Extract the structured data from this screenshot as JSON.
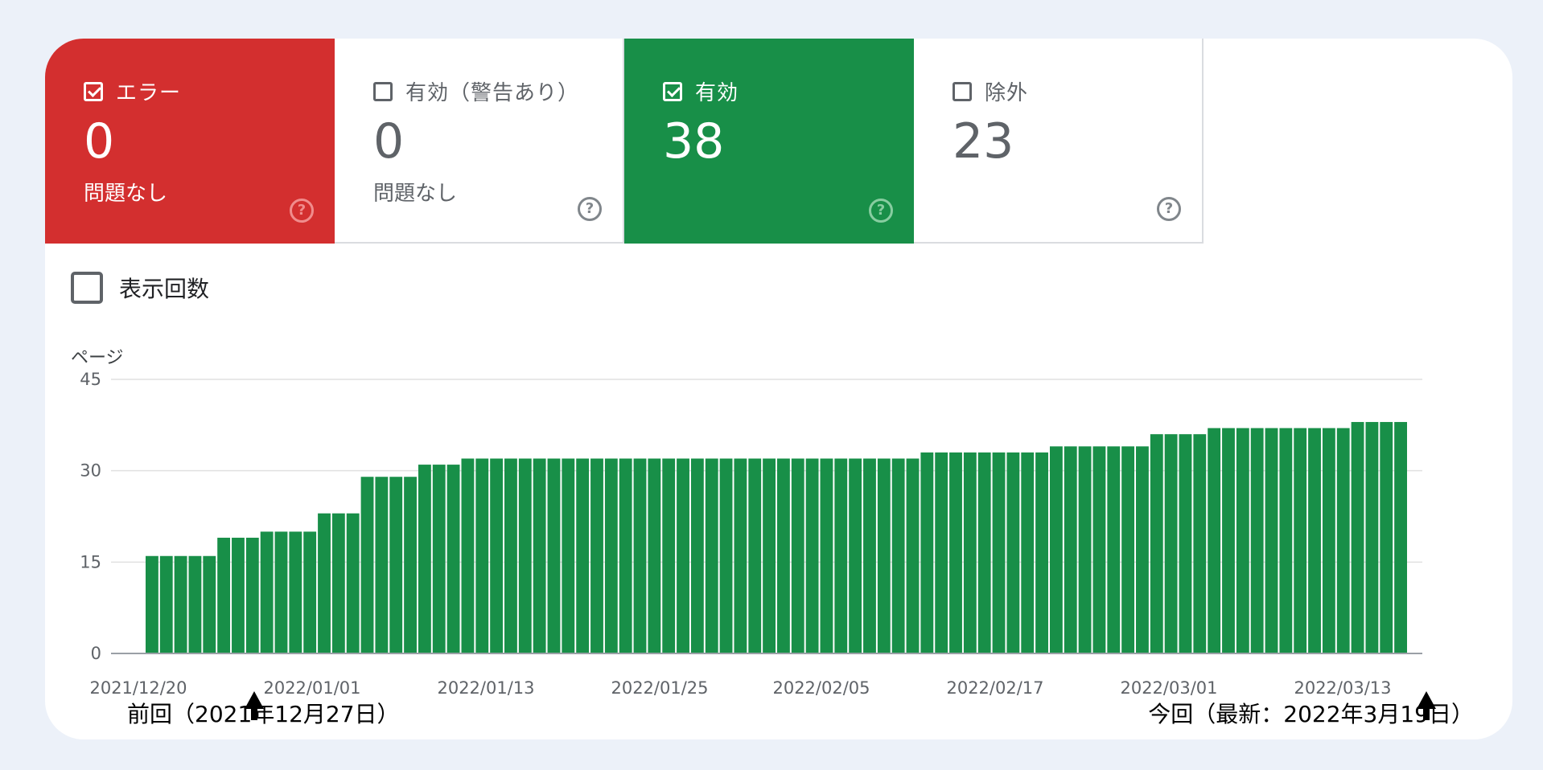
{
  "tiles": [
    {
      "label": "エラー",
      "value": "0",
      "sub": "問題なし",
      "checked": true
    },
    {
      "label": "有効（警告あり）",
      "value": "0",
      "sub": "問題なし",
      "checked": false
    },
    {
      "label": "有効",
      "value": "38",
      "sub": "",
      "checked": true
    },
    {
      "label": "除外",
      "value": "23",
      "sub": "",
      "checked": false
    }
  ],
  "impressions_label": "表示回数",
  "help_glyph": "?",
  "colors": {
    "error": "#d32f2f",
    "valid": "#188f48",
    "bar": "#188f48",
    "background": "#ecf1f9"
  },
  "annotations": {
    "previous": "前回（2021年12月27日）",
    "current": "今回（最新：2022年3月19日）"
  },
  "chart_data": {
    "type": "bar",
    "ylabel": "ページ",
    "ylim": [
      0,
      45
    ],
    "yticks": [
      "0",
      "15",
      "30",
      "45"
    ],
    "xticks": [
      "2021/12/20",
      "2022/01/01",
      "2022/01/13",
      "2022/01/25",
      "2022/02/05",
      "2022/02/17",
      "2022/03/01",
      "2022/03/13"
    ],
    "series": [
      {
        "values": [
          16,
          16,
          16,
          16,
          16,
          19,
          19,
          19,
          20,
          20,
          20,
          20,
          23,
          23,
          23,
          29,
          29,
          29,
          29,
          31,
          31,
          31,
          32,
          32,
          32,
          32,
          32,
          32,
          32,
          32,
          32,
          32,
          32,
          32,
          32,
          32,
          32,
          32,
          32,
          32,
          32,
          32,
          32,
          32,
          32,
          32,
          32,
          32,
          32,
          32,
          32,
          32,
          32,
          32,
          33,
          33,
          33,
          33,
          33,
          33,
          33,
          33,
          33,
          34,
          34,
          34,
          34,
          34,
          34,
          34,
          36,
          36,
          36,
          36,
          37,
          37,
          37,
          37,
          37,
          37,
          37,
          37,
          37,
          37,
          38,
          38,
          38,
          38
        ]
      }
    ]
  }
}
